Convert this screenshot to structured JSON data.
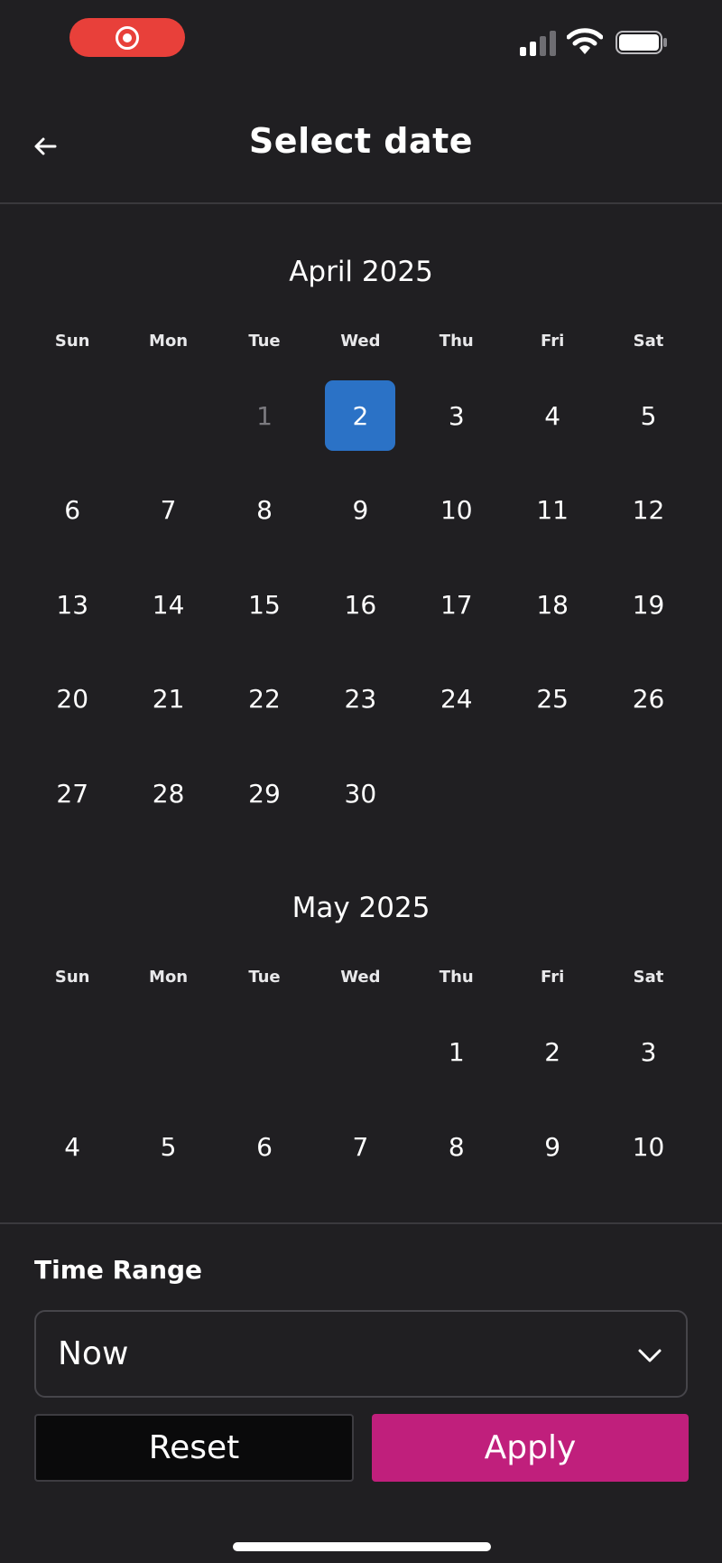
{
  "header": {
    "title": "Select date"
  },
  "calendar": {
    "weekdays": [
      "Sun",
      "Mon",
      "Tue",
      "Wed",
      "Thu",
      "Fri",
      "Sat"
    ],
    "months": [
      {
        "title": "April 2025",
        "weeks": [
          [
            "",
            "",
            "1",
            "2",
            "3",
            "4",
            "5"
          ],
          [
            "6",
            "7",
            "8",
            "9",
            "10",
            "11",
            "12"
          ],
          [
            "13",
            "14",
            "15",
            "16",
            "17",
            "18",
            "19"
          ],
          [
            "20",
            "21",
            "22",
            "23",
            "24",
            "25",
            "26"
          ],
          [
            "27",
            "28",
            "29",
            "30",
            "",
            "",
            ""
          ]
        ],
        "selected": "2",
        "disabled": [
          "1"
        ]
      },
      {
        "title": "May 2025",
        "weeks": [
          [
            "",
            "",
            "",
            "",
            "1",
            "2",
            "3"
          ],
          [
            "4",
            "5",
            "6",
            "7",
            "8",
            "9",
            "10"
          ]
        ],
        "selected": null,
        "disabled": []
      }
    ]
  },
  "footer": {
    "time_range_label": "Time Range",
    "time_range_value": "Now",
    "reset_label": "Reset",
    "apply_label": "Apply"
  },
  "colors": {
    "background": "#201f22",
    "selected_day": "#2b72c6",
    "apply_button": "#c01f7c",
    "record_pill": "#e8403a"
  },
  "icons": {
    "status": [
      "record-icon",
      "signal-icon",
      "wifi-icon",
      "battery-icon"
    ],
    "back": "arrow-left-icon",
    "dropdown": "chevron-down-icon"
  }
}
